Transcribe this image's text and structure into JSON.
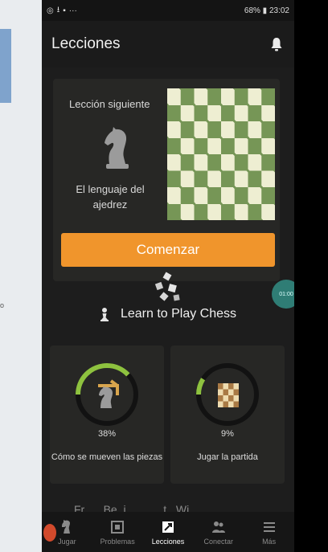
{
  "status_bar": {
    "right": "68% ▮ 23:02"
  },
  "app_bar": {
    "title": "Lecciones"
  },
  "lesson_card": {
    "next_label": "Lección siguiente",
    "lesson_name": "El lenguaje del ajedrez",
    "start_button": "Comenzar"
  },
  "section": {
    "title": "Learn to Play Chess",
    "fab_label": "01:00"
  },
  "courses": [
    {
      "percent_label": "38%",
      "progress": 0.38,
      "label": "Cómo se mueven las piezas"
    },
    {
      "percent_label": "9%",
      "progress": 0.09,
      "label": "Jugar la partida"
    }
  ],
  "peek_text": "Fr_ _ Be_i_ _ _ _ t_ Wi_",
  "tabs": [
    {
      "label": "Jugar",
      "icon": "play-icon"
    },
    {
      "label": "Problemas",
      "icon": "puzzle-icon"
    },
    {
      "label": "Lecciones",
      "icon": "lessons-icon",
      "active": true
    },
    {
      "label": "Conectar",
      "icon": "connect-icon"
    },
    {
      "label": "Más",
      "icon": "more-icon"
    }
  ],
  "colors": {
    "accent": "#f0952c",
    "progress": "#8ec23f",
    "board_dark": "#769656",
    "board_light": "#eeeed2"
  }
}
